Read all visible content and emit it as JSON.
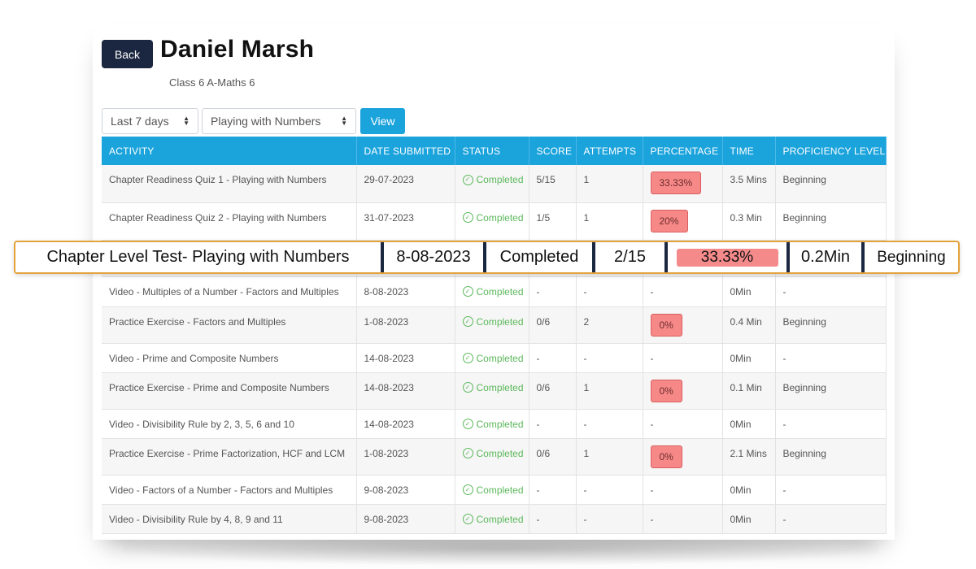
{
  "header": {
    "back_label": "Back",
    "student_name": "Daniel Marsh",
    "class_name": "Class 6 A-Maths 6"
  },
  "filters": {
    "period_selected": "Last 7 days",
    "chapter_selected": "Playing with Numbers",
    "view_label": "View"
  },
  "table": {
    "columns": [
      "ACTIVITY",
      "DATE SUBMITTED",
      "STATUS",
      "SCORE",
      "ATTEMPTS",
      "PERCENTAGE",
      "TIME",
      "PROFICIENCY LEVEL"
    ],
    "rows": [
      {
        "activity": "Chapter Readiness Quiz 1 - Playing with Numbers",
        "date": "29-07-2023",
        "status": "Completed",
        "score": "5/15",
        "attempts": "1",
        "percentage": "33.33%",
        "time": "3.5 Mins",
        "proficiency": "Beginning"
      },
      {
        "activity": "Chapter Readiness Quiz 2 - Playing with Numbers",
        "date": "31-07-2023",
        "status": "Completed",
        "score": "1/5",
        "attempts": "1",
        "percentage": "20%",
        "time": "0.3 Min",
        "proficiency": "Beginning"
      },
      {
        "activity": "Video - Multiples of a Number - Factors and Multiples",
        "date": "8-08-2023",
        "status": "Completed",
        "score": "-",
        "attempts": "-",
        "percentage": "-",
        "time": "0Min",
        "proficiency": "-"
      },
      {
        "activity": "Practice Exercise - Factors and Multiples",
        "date": "1-08-2023",
        "status": "Completed",
        "score": "0/6",
        "attempts": "2",
        "percentage": "0%",
        "time": "0.4 Min",
        "proficiency": "Beginning"
      },
      {
        "activity": "Video - Prime and Composite Numbers",
        "date": "14-08-2023",
        "status": "Completed",
        "score": "-",
        "attempts": "-",
        "percentage": "-",
        "time": "0Min",
        "proficiency": "-"
      },
      {
        "activity": "Practice Exercise - Prime and Composite Numbers",
        "date": "14-08-2023",
        "status": "Completed",
        "score": "0/6",
        "attempts": "1",
        "percentage": "0%",
        "time": "0.1 Min",
        "proficiency": "Beginning"
      },
      {
        "activity": "Video - Divisibility Rule by 2, 3, 5, 6 and 10",
        "date": "14-08-2023",
        "status": "Completed",
        "score": "-",
        "attempts": "-",
        "percentage": "-",
        "time": "0Min",
        "proficiency": "-"
      },
      {
        "activity": "Practice Exercise - Prime Factorization, HCF and LCM",
        "date": "1-08-2023",
        "status": "Completed",
        "score": "0/6",
        "attempts": "1",
        "percentage": "0%",
        "time": "2.1 Mins",
        "proficiency": "Beginning"
      },
      {
        "activity": "Video - Factors of a Number - Factors and Multiples",
        "date": "9-08-2023",
        "status": "Completed",
        "score": "-",
        "attempts": "-",
        "percentage": "-",
        "time": "0Min",
        "proficiency": "-"
      },
      {
        "activity": "Video - Divisibility Rule by 4, 8, 9 and 11",
        "date": "9-08-2023",
        "status": "Completed",
        "score": "-",
        "attempts": "-",
        "percentage": "-",
        "time": "0Min",
        "proficiency": "-"
      }
    ]
  },
  "highlight_row": {
    "activity": "Chapter Level Test- Playing with Numbers",
    "date": "8-08-2023",
    "status": "Completed",
    "score": "2/15",
    "percentage": "33.33%",
    "time": "0.2Min",
    "proficiency": "Beginning"
  },
  "icons": {
    "status_icon": "check-circle-icon",
    "select_icon": "up-down-arrows-icon"
  },
  "colors": {
    "header_blue": "#1ba3dc",
    "back_button": "#1b2740",
    "completed_green": "#5cb85c",
    "percentage_badge": "#f78888",
    "highlight_border": "#e3a23a"
  }
}
